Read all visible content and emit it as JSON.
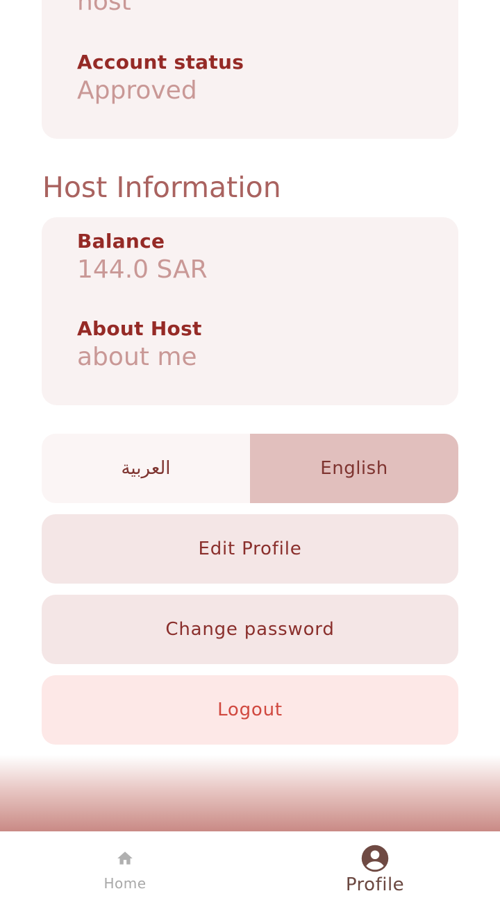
{
  "account_card": {
    "role_value": "host",
    "status_label": "Account status",
    "status_value": "Approved"
  },
  "host_section": {
    "title": "Host Information",
    "balance_label": "Balance",
    "balance_value": "144.0 SAR",
    "about_label": "About Host",
    "about_value": "about me"
  },
  "language": {
    "arabic_label": "العربية",
    "english_label": "English",
    "selected": "English"
  },
  "actions": {
    "edit_profile": "Edit Profile",
    "change_password": "Change password",
    "logout": "Logout"
  },
  "bottom_nav": {
    "items": [
      {
        "label": "Home",
        "icon": "home-icon",
        "active": false
      },
      {
        "label": "Profile",
        "icon": "account-circle-icon",
        "active": true
      }
    ]
  },
  "colors": {
    "accent": "#952a26",
    "card_bg": "#f9f2f2",
    "selected_lang_bg": "#e1bfbd",
    "logout_text": "#d0483f"
  }
}
